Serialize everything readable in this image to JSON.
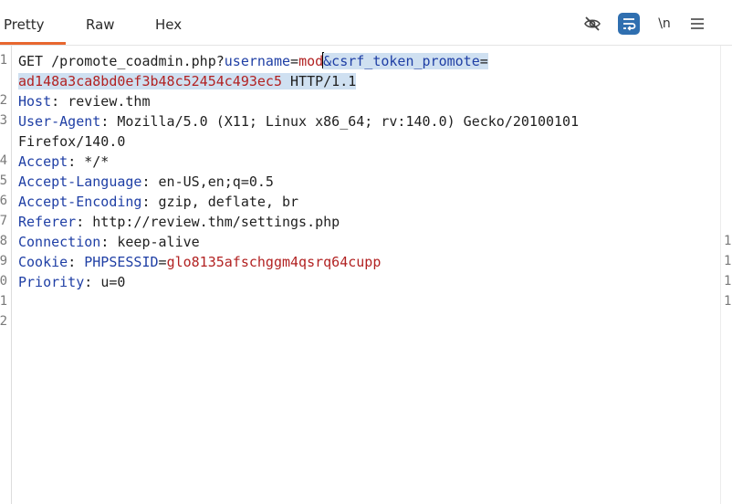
{
  "tabs": [
    {
      "label": "Pretty"
    },
    {
      "label": "Raw"
    },
    {
      "label": "Hex"
    }
  ],
  "toolbar": {
    "hide_icon": "eye-slash-icon",
    "wrap_icon": "word-wrap-icon",
    "newline_label": "\\n",
    "menu_icon": "hamburger-menu-icon"
  },
  "accent_color": "#e8672f",
  "editor": {
    "line_numbers": [
      "1",
      "2",
      "3",
      "4",
      "5",
      "6",
      "7",
      "8",
      "9",
      "0",
      "1",
      "2"
    ],
    "right_markers": [
      "1",
      "1",
      "1",
      "1"
    ],
    "request": {
      "method": "GET",
      "path": "/promote_coadmin.php?",
      "param1_name": "username",
      "eq": "=",
      "param1_value": "mod",
      "param2_name": "&csrf_token_promote",
      "token": "ad148a3ca8bd0ef3b48c52454c493ec5",
      "protocol": "HTTP/1.1"
    },
    "headers": {
      "host_name": "Host",
      "host_value": "review.thm",
      "ua_name": "User-Agent",
      "ua_value": "Mozilla/5.0 (X11; Linux x86_64; rv:140.0) Gecko/20100101",
      "ua_cont": "Firefox/140.0",
      "accept_name": "Accept",
      "accept_value": "*/*",
      "lang_name": "Accept-Language",
      "lang_value": "en-US,en;q=0.5",
      "enc_name": "Accept-Encoding",
      "enc_value": "gzip, deflate, br",
      "ref_name": "Referer",
      "ref_value": "http://review.thm/settings.php",
      "conn_name": "Connection",
      "conn_value": "keep-alive",
      "cookie_name": "Cookie",
      "cookie_key": "PHPSESSID",
      "cookie_value": "glo8135afschggm4qsrq64cupp",
      "prio_name": "Priority",
      "prio_value": "u=0"
    }
  }
}
